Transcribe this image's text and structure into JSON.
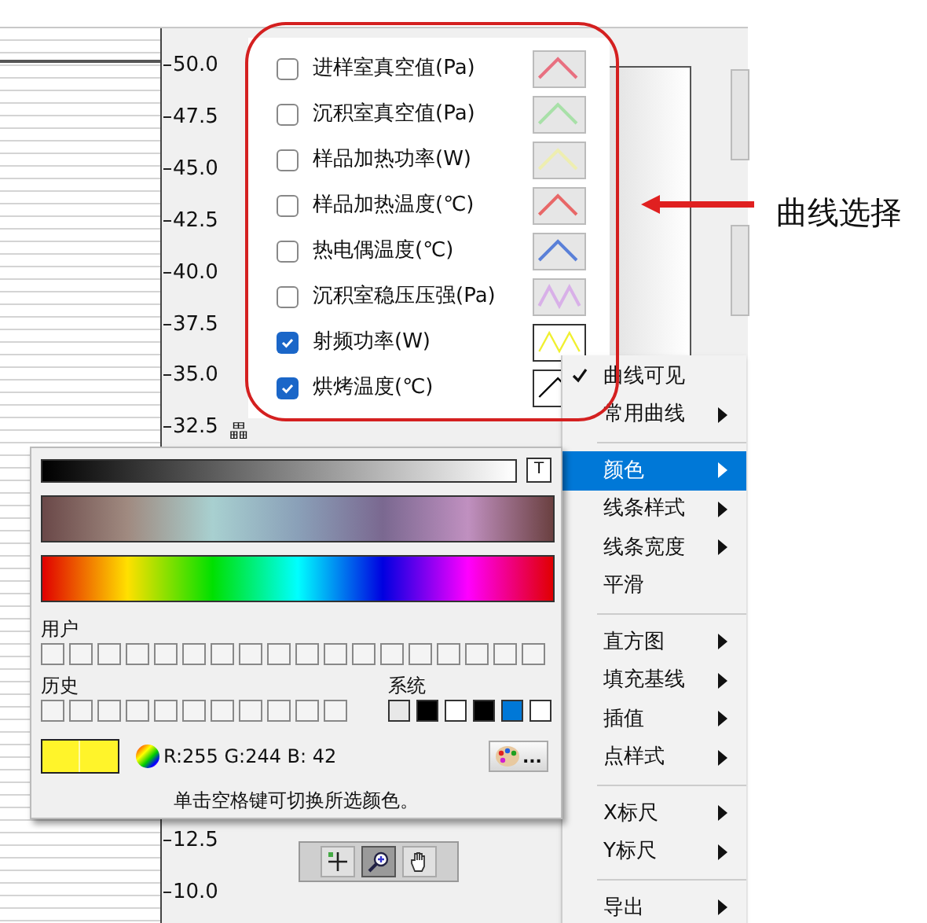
{
  "y_axis": {
    "upper_labels": [
      "50.0",
      "47.5",
      "45.0",
      "42.5",
      "40.0",
      "37.5",
      "35.0",
      "32.5"
    ],
    "lower_labels": [
      "12.5",
      "10.0"
    ],
    "glyph": "畾"
  },
  "curves": [
    {
      "label": "进样室真空值(Pa)",
      "checked": false,
      "color": "#e87080",
      "kind": "peak"
    },
    {
      "label": "沉积室真空值(Pa)",
      "checked": false,
      "color": "#a8e0a8",
      "kind": "peak"
    },
    {
      "label": "样品加热功率(W)",
      "checked": false,
      "color": "#eeeeb0",
      "kind": "peak"
    },
    {
      "label": "样品加热温度(℃)",
      "checked": false,
      "color": "#e86868",
      "kind": "peak"
    },
    {
      "label": "热电偶温度(℃)",
      "checked": false,
      "color": "#5a80d8",
      "kind": "peak"
    },
    {
      "label": "沉积室稳压压强(Pa)",
      "checked": false,
      "color": "#d8b0e8",
      "kind": "wave"
    },
    {
      "label": "射频功率(W)",
      "checked": true,
      "color": "#f0f030",
      "kind": "wave"
    },
    {
      "label": "烘烤温度(℃)",
      "checked": true,
      "color": "#000000",
      "kind": "peak"
    }
  ],
  "annotation": {
    "label": "曲线选择"
  },
  "context_menu": [
    {
      "kind": "item",
      "label": "曲线可见",
      "checked": true,
      "submenu": false,
      "selected": false
    },
    {
      "kind": "item",
      "label": "常用曲线",
      "checked": false,
      "submenu": true,
      "selected": false
    },
    {
      "kind": "separator"
    },
    {
      "kind": "item",
      "label": "颜色",
      "checked": false,
      "submenu": true,
      "selected": true
    },
    {
      "kind": "item",
      "label": "线条样式",
      "checked": false,
      "submenu": true,
      "selected": false
    },
    {
      "kind": "item",
      "label": "线条宽度",
      "checked": false,
      "submenu": true,
      "selected": false
    },
    {
      "kind": "item",
      "label": "平滑",
      "checked": false,
      "submenu": false,
      "selected": false
    },
    {
      "kind": "separator"
    },
    {
      "kind": "item",
      "label": "直方图",
      "checked": false,
      "submenu": true,
      "selected": false
    },
    {
      "kind": "item",
      "label": "填充基线",
      "checked": false,
      "submenu": true,
      "selected": false
    },
    {
      "kind": "item",
      "label": "插值",
      "checked": false,
      "submenu": true,
      "selected": false
    },
    {
      "kind": "item",
      "label": "点样式",
      "checked": false,
      "submenu": true,
      "selected": false
    },
    {
      "kind": "separator"
    },
    {
      "kind": "item",
      "label": "X标尺",
      "checked": false,
      "submenu": true,
      "selected": false
    },
    {
      "kind": "item",
      "label": "Y标尺",
      "checked": false,
      "submenu": true,
      "selected": false
    },
    {
      "kind": "separator"
    },
    {
      "kind": "item",
      "label": "导出",
      "checked": false,
      "submenu": true,
      "selected": false
    }
  ],
  "color_picker": {
    "t_button": "T",
    "user_label": "用户",
    "history_label": "历史",
    "system_label": "系统",
    "system_swatches": [
      {
        "color": "#e8e8e8"
      },
      {
        "color": "#000000"
      },
      {
        "color": "#ffffff"
      },
      {
        "color": "#000000"
      },
      {
        "color": "#0078d7"
      },
      {
        "color": "#ffffff"
      }
    ],
    "current": {
      "color": "#fff42a"
    },
    "rgb": "R:255 G:244 B: 42",
    "more_button": "...",
    "hint": "单击空格键可切换所选颜色。"
  },
  "tools": [
    {
      "selected": false
    },
    {
      "selected": true
    },
    {
      "selected": false
    }
  ]
}
